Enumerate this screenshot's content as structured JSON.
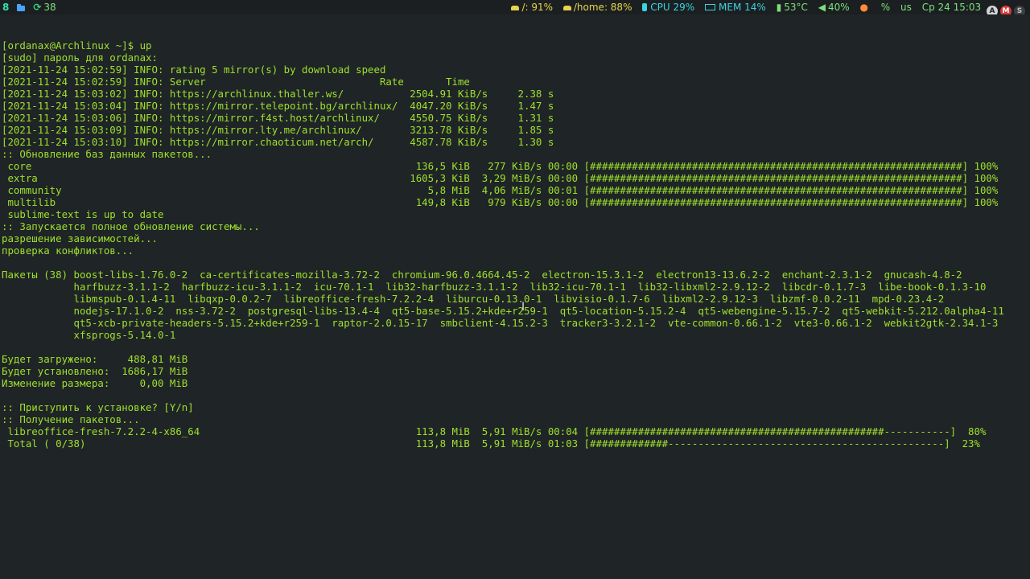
{
  "statusbar": {
    "workspace": "8",
    "updates_count": "38",
    "root_disk": "/: 91%",
    "home_disk": "/home: 88%",
    "cpu": "CPU 29%",
    "mem": "MEM 14%",
    "temp": "53°C",
    "volume": "40%",
    "brightness_icon": "bulb-icon",
    "layout_percent": "%",
    "keyboard_layout": "us",
    "datetime": "Ср 24 15:03",
    "tray": [
      "A",
      "M",
      "S"
    ]
  },
  "terminal": {
    "lines": [
      "[ordanax@Archlinux ~]$ up",
      "[sudo] пароль для ordanax:",
      "[2021-11-24 15:02:59] INFO: rating 5 mirror(s) by download speed",
      "[2021-11-24 15:02:59] INFO: Server                             Rate       Time",
      "[2021-11-24 15:03:02] INFO: https://archlinux.thaller.ws/           2504.91 KiB/s     2.38 s",
      "[2021-11-24 15:03:04] INFO: https://mirror.telepoint.bg/archlinux/  4047.20 KiB/s     1.47 s",
      "[2021-11-24 15:03:06] INFO: https://mirror.f4st.host/archlinux/     4550.75 KiB/s     1.31 s",
      "[2021-11-24 15:03:09] INFO: https://mirror.lty.me/archlinux/        3213.78 KiB/s     1.85 s",
      "[2021-11-24 15:03:10] INFO: https://mirror.chaoticum.net/arch/      4587.78 KiB/s     1.30 s",
      ":: Обновление баз данных пакетов...",
      " core                                                                136,5 KiB   277 KiB/s 00:00 [##############################################################] 100%",
      " extra                                                              1605,3 KiB  3,29 MiB/s 00:00 [##############################################################] 100%",
      " community                                                             5,8 MiB  4,06 MiB/s 00:01 [##############################################################] 100%",
      " multilib                                                            149,8 KiB   979 KiB/s 00:00 [##############################################################] 100%",
      " sublime-text is up to date",
      ":: Запускается полное обновление системы...",
      "разрешение зависимостей...",
      "проверка конфликтов...",
      "",
      "Пакеты (38) boost-libs-1.76.0-2  ca-certificates-mozilla-3.72-2  chromium-96.0.4664.45-2  electron-15.3.1-2  electron13-13.6.2-2  enchant-2.3.1-2  gnucash-4.8-2",
      "            harfbuzz-3.1.1-2  harfbuzz-icu-3.1.1-2  icu-70.1-1  lib32-harfbuzz-3.1.1-2  lib32-icu-70.1-1  lib32-libxml2-2.9.12-2  libcdr-0.1.7-3  libe-book-0.1.3-10",
      "            libmspub-0.1.4-11  libqxp-0.0.2-7  libreoffice-fresh-7.2.2-4  liburcu-0.13.0-1  libvisio-0.1.7-6  libxml2-2.9.12-3  libzmf-0.0.2-11  mpd-0.23.4-2",
      "            nodejs-17.1.0-2  nss-3.72-2  postgresql-libs-13.4-4  qt5-base-5.15.2+kde+r259-1  qt5-location-5.15.2-4  qt5-webengine-5.15.7-2  qt5-webkit-5.212.0alpha4-11",
      "            qt5-xcb-private-headers-5.15.2+kde+r259-1  raptor-2.0.15-17  smbclient-4.15.2-3  tracker3-3.2.1-2  vte-common-0.66.1-2  vte3-0.66.1-2  webkit2gtk-2.34.1-3",
      "            xfsprogs-5.14.0-1",
      "",
      "Будет загружено:     488,81 MiB",
      "Будет установлено:  1686,17 MiB",
      "Изменение размера:     0,00 MiB",
      "",
      ":: Приступить к установке? [Y/n]",
      ":: Получение пакетов...",
      " libreoffice-fresh-7.2.2-4-x86_64                                    113,8 MiB  5,91 MiB/s 00:04 [#################################################-----------]  80%",
      " Total ( 0/38)                                                       113,8 MiB  5,91 MiB/s 01:03 [#############----------------------------------------------]  23%"
    ]
  }
}
